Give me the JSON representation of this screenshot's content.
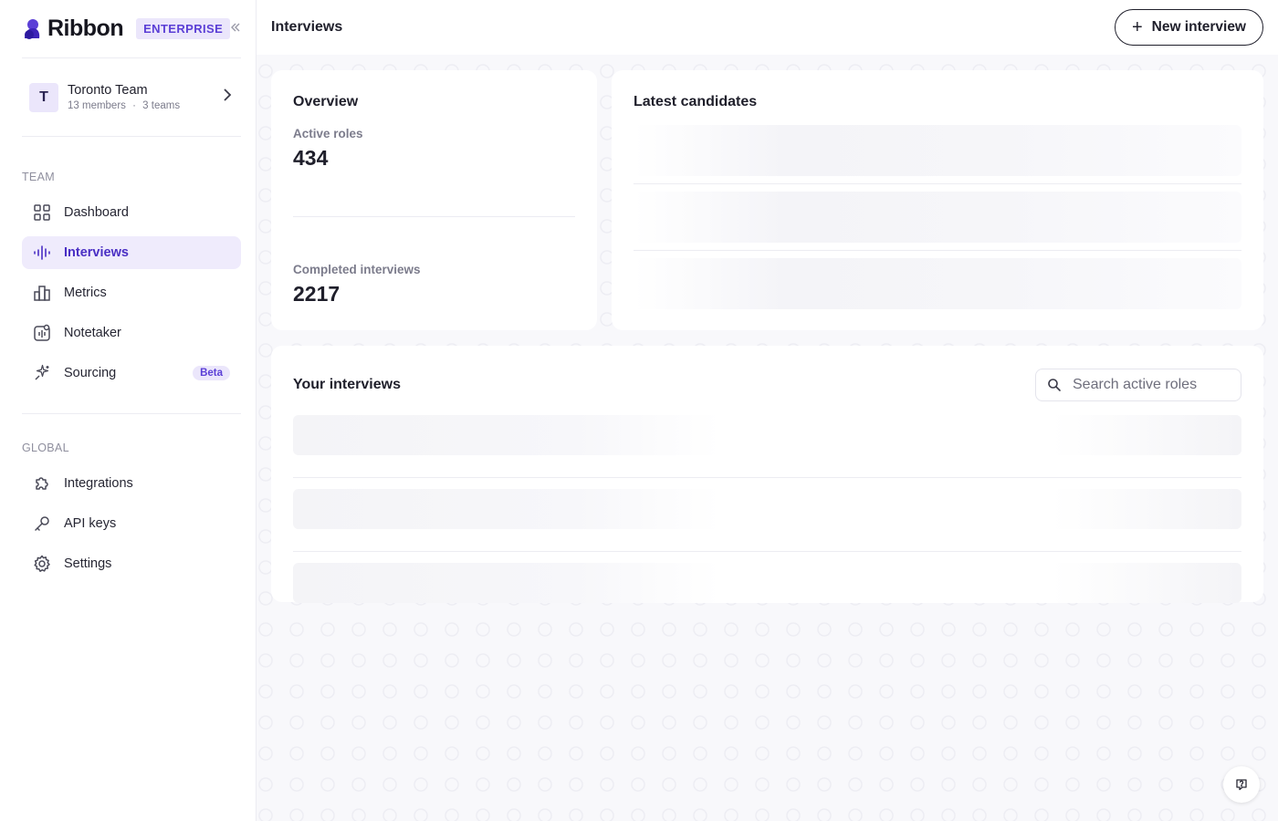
{
  "brand": {
    "name": "Ribbon",
    "badge": "ENTERPRISE",
    "accent_color": "#4a2fc4",
    "collapse_icon": "double-chevron-left-icon"
  },
  "team": {
    "avatar_letter": "T",
    "name": "Toronto Team",
    "members": "13 members",
    "separator": "·",
    "teams": "3 teams"
  },
  "sidebar": {
    "team_section_label": "TEAM",
    "global_section_label": "GLOBAL",
    "team_items": [
      {
        "label": "Dashboard",
        "icon": "grid-icon",
        "active": false
      },
      {
        "label": "Interviews",
        "icon": "waveform-icon",
        "active": true
      },
      {
        "label": "Metrics",
        "icon": "bar-chart-icon",
        "active": false
      },
      {
        "label": "Notetaker",
        "icon": "notetaker-icon",
        "active": false
      },
      {
        "label": "Sourcing",
        "icon": "sparkle-icon",
        "active": false,
        "badge": "Beta"
      }
    ],
    "global_items": [
      {
        "label": "Integrations",
        "icon": "puzzle-icon"
      },
      {
        "label": "API keys",
        "icon": "key-icon"
      },
      {
        "label": "Settings",
        "icon": "gear-icon"
      }
    ]
  },
  "header": {
    "title": "Interviews",
    "new_button_label": "New interview"
  },
  "overview": {
    "title": "Overview",
    "active_roles_label": "Active roles",
    "active_roles_value": "434",
    "completed_label": "Completed interviews",
    "completed_value": "2217"
  },
  "candidates": {
    "title": "Latest candidates"
  },
  "your_interviews": {
    "title": "Your interviews",
    "search_placeholder": "Search active roles"
  }
}
